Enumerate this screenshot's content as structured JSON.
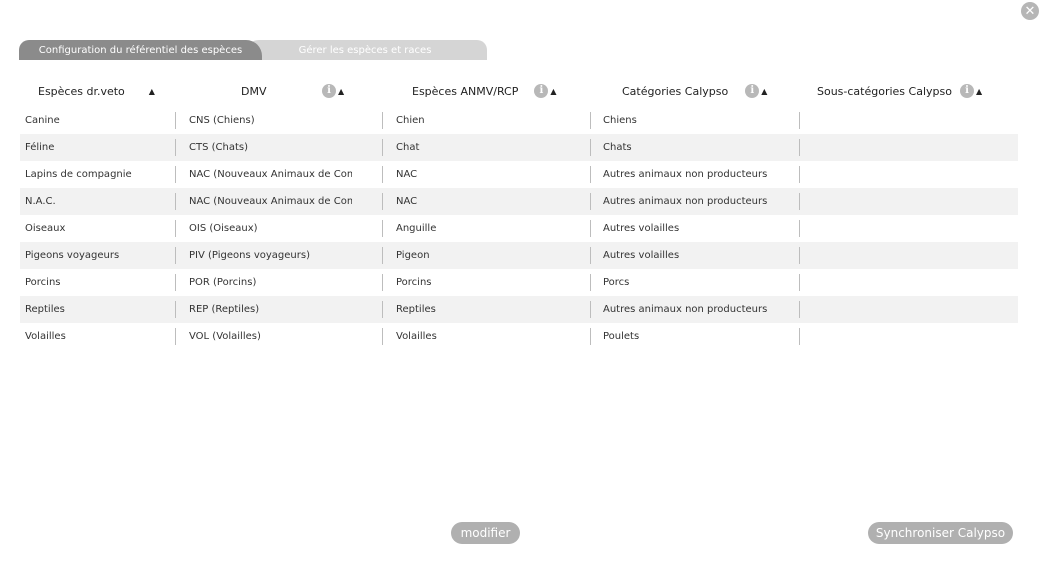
{
  "close_label": "✕",
  "tabs": [
    {
      "label": "Configuration du référentiel des espèces"
    },
    {
      "label": "Gérer les espèces et races"
    }
  ],
  "headers": [
    {
      "label": "Espèces dr.veto",
      "has_info": false
    },
    {
      "label": "DMV",
      "has_info": true
    },
    {
      "label": "Espèces ANMV/RCP",
      "has_info": true
    },
    {
      "label": "Catégories Calypso",
      "has_info": true
    },
    {
      "label": "Sous-catégories Calypso",
      "has_info": true
    }
  ],
  "info_glyph": "i",
  "sort_glyph": "▲",
  "rows": [
    [
      "Canine",
      "CNS (Chiens)",
      "Chien",
      "Chiens",
      ""
    ],
    [
      "Féline",
      "CTS (Chats)",
      "Chat",
      "Chats",
      ""
    ],
    [
      "Lapins de compagnie",
      "NAC (Nouveaux Animaux de Compagnie)",
      "NAC",
      "Autres animaux non producteurs",
      ""
    ],
    [
      "N.A.C.",
      "NAC (Nouveaux Animaux de Compagnie)",
      "NAC",
      "Autres animaux non producteurs",
      ""
    ],
    [
      "Oiseaux",
      "OIS (Oiseaux)",
      "Anguille",
      "Autres volailles",
      ""
    ],
    [
      "Pigeons voyageurs",
      "PIV (Pigeons voyageurs)",
      "Pigeon",
      "Autres volailles",
      ""
    ],
    [
      "Porcins",
      "POR (Porcins)",
      "Porcins",
      "Porcs",
      ""
    ],
    [
      "Reptiles",
      "REP (Reptiles)",
      "Reptiles",
      "Autres animaux non producteurs",
      ""
    ],
    [
      "Volailles",
      "VOL (Volailles)",
      "Volailles",
      "Poulets",
      ""
    ]
  ],
  "buttons": {
    "modifier": "modifier",
    "sync": "Synchroniser Calypso"
  }
}
